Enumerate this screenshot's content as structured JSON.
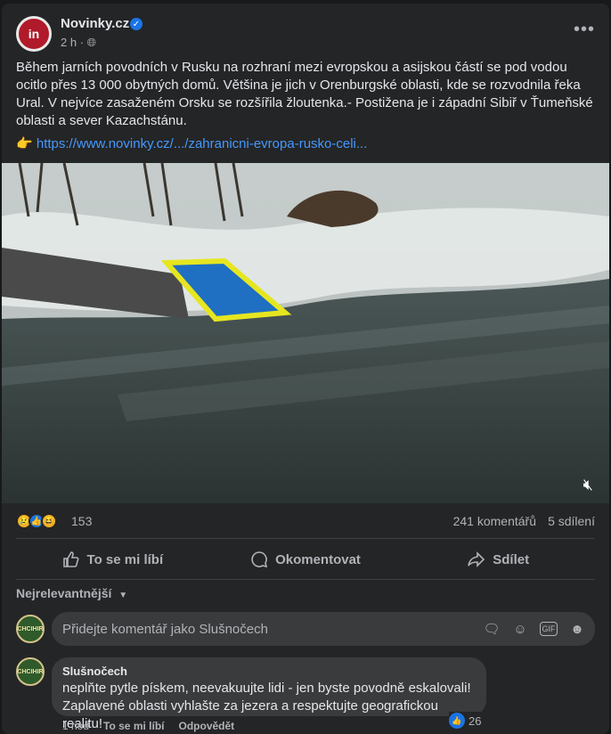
{
  "post": {
    "page_name": "Novinky.cz",
    "avatar_text": "in",
    "time": "2 h",
    "text": "Během jarních povodních v Rusku na rozhraní mezi evropskou a asijskou částí se pod vodou ocitlo přes 13 000 obytných domů. Většina je jich v Orenburgské oblasti, kde se rozvodnila řeka Ural. V nejvíce zasaženém Orsku se rozšířila žloutenka.- Postižena je i západní Sibiř v Ťumeňské oblasti a sever Kazachstánu.",
    "link_emoji": "👉",
    "link": "https://www.novinky.cz/.../zahranicni-evropa-rusko-celi...",
    "more": "•••"
  },
  "stats": {
    "reaction_count": "153",
    "comments": "241 komentářů",
    "shares": "5 sdílení",
    "reaction_icons": [
      "sad",
      "like",
      "haha"
    ]
  },
  "actions": {
    "like": "To se mi líbí",
    "comment": "Okomentovat",
    "share": "Sdílet"
  },
  "comments_section": {
    "sort": "Nejrelevantnější",
    "input_placeholder": "Přidejte komentář jako Slušnočech",
    "avatar_text": "CHCIHIR"
  },
  "comment": {
    "author": "Slušnočech",
    "text": "neplňte pytle pískem, neevakuujte lidi - jen byste povodně eskalovali! Zaplavené oblasti vyhlašte za jezera a respektujte geografickou realitu!",
    "time": "1 hod",
    "like": "To se mi líbí",
    "reply": "Odpovědět",
    "reactions": "26"
  },
  "colors": {
    "background": "#18191a",
    "card": "#242526",
    "link": "#4599ff",
    "accent": "#1b74e4"
  }
}
